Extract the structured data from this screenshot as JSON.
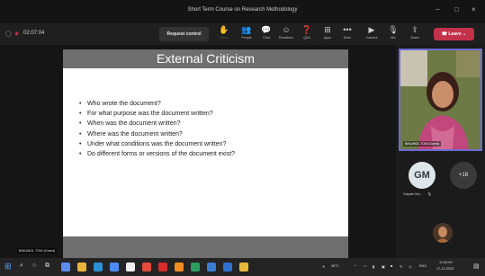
{
  "window": {
    "title": "Short Term Course on Research Methodology",
    "minimize": "−",
    "maximize": "□",
    "close": "×"
  },
  "toolbar": {
    "timer": "02:07:04",
    "request_control": "Request control",
    "buttons": [
      {
        "icon": "raise-hand-icon",
        "glyph": "✋",
        "label": "Raise",
        "dim": true
      },
      {
        "icon": "people-icon",
        "glyph": "👥",
        "label": "People",
        "dim": false
      },
      {
        "icon": "chat-icon",
        "glyph": "💬",
        "label": "Chat",
        "dim": false
      },
      {
        "icon": "reactions-icon",
        "glyph": "☺",
        "label": "Reactions",
        "dim": false
      },
      {
        "icon": "qna-icon",
        "glyph": "❓",
        "label": "Q&A",
        "dim": false
      },
      {
        "icon": "apps-icon",
        "glyph": "⊞",
        "label": "Apps",
        "dim": false
      },
      {
        "icon": "more-icon",
        "glyph": "•••",
        "label": "More",
        "dim": false
      },
      {
        "icon": "camera-icon",
        "glyph": "▶",
        "label": "Camera",
        "dim": false
      },
      {
        "icon": "mic-icon",
        "glyph": "🎙",
        "label": "Mic",
        "dim": false
      },
      {
        "icon": "share-icon",
        "glyph": "⇪",
        "label": "Share",
        "dim": false
      }
    ],
    "leave": "Leave"
  },
  "slide": {
    "title": "External Criticism",
    "bullets": [
      "Who wrote the document?",
      "For what purpose was the document written?",
      "When was the document written?",
      "Where was the document written?",
      "Under what conditions was the document written?",
      "Do different forms or versions of the document exist?"
    ],
    "presenter_tag": "BINUMOL TOM (Guest)"
  },
  "participants": {
    "camera_name": "BINUMOL TOM (Guest)",
    "gm_initials": "GM",
    "gm_name": "Gayatri Ma...",
    "more_count": "+18"
  },
  "taskbar": {
    "weather": "28°C",
    "lang": "ENG",
    "time": "11:53:09",
    "date": "17-12-2022"
  },
  "colors": {
    "accent": "#6c6bd3",
    "leave": "#c4314b",
    "record": "#c4314b"
  }
}
